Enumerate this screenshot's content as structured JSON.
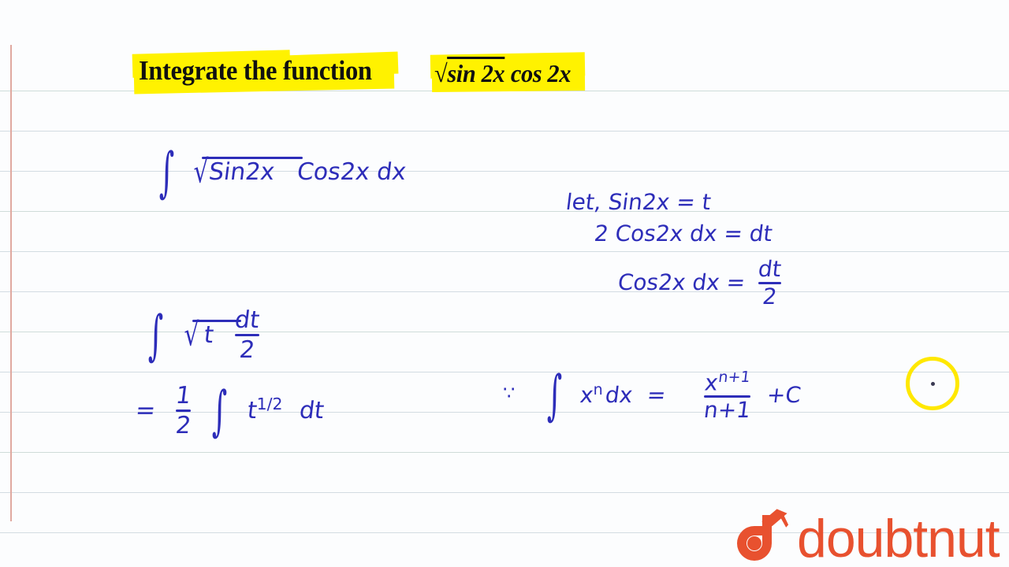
{
  "page": {
    "background_color": "#fcfdfe",
    "rule_color": "#d3dce2",
    "margin_line_color": "#e0a9a0",
    "ink_color": "#2d2db9",
    "highlighter_color": "#fff200",
    "brand_color": "#e8512f"
  },
  "question": {
    "label": "Integrate the function",
    "formula_radical_prefix": "√",
    "formula_radicand": "sin 2x",
    "formula_tail": "cos 2x",
    "formula_plain": "√sin 2x cos 2x"
  },
  "solution": {
    "line1": {
      "integral": "∫",
      "sqrt": "√",
      "radicand": "Sin2x",
      "rest": "Cos2x dx",
      "plain": "∫ √Sin2x Cos2x dx"
    },
    "substitution": {
      "step1": "let,  Sin2x = t",
      "step2": "2 Cos2x dx = dt",
      "step3_lhs": "Cos2x dx =",
      "step3_num": "dt",
      "step3_den": "2",
      "step3_plain": "Cos2x dx = dt/2"
    },
    "line2": {
      "integral": "∫",
      "sqrt": "√",
      "radicand": "t",
      "num": "dt",
      "den": "2",
      "plain": "∫ √t dt/2"
    },
    "line3": {
      "equals": "=",
      "coef_num": "1",
      "coef_den": "2",
      "integral": "∫",
      "base": "t",
      "exponent_num": "1",
      "exponent_den": "2",
      "differential": "dt",
      "plain": "= 1/2 ∫ t^(1/2) dt"
    },
    "power_rule": {
      "because": "∵",
      "integral": "∫",
      "integrand": "x",
      "exponent": "n",
      "differential": "dx",
      "equals": "=",
      "result_num_base": "x",
      "result_num_exp": "n+1",
      "result_den": "n+1",
      "constant": "+C",
      "plain": "∵ ∫ xⁿ dx = x^(n+1)/(n+1) +C"
    }
  },
  "brand": {
    "name": "doubtnut",
    "mark": "graduation-cap-d-logo"
  },
  "cursor": {
    "ring_color": "#ffe800",
    "dot_color": "#3a3a52"
  }
}
